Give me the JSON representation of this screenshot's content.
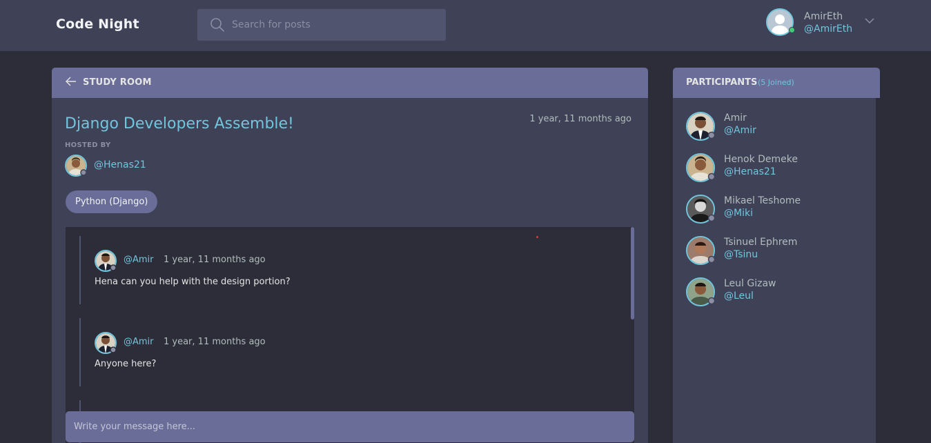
{
  "header": {
    "logo": "Code Night",
    "search_placeholder": "Search for posts",
    "user": {
      "name": "AmirEth",
      "handle": "@AmirEth"
    }
  },
  "room": {
    "back_label": "STUDY ROOM",
    "title": "Django Developers Assemble!",
    "time": "1 year, 11 months ago",
    "hosted_by_label": "HOSTED BY",
    "host_handle": "@Henas21",
    "topic": "Python (Django)",
    "messages": [
      {
        "handle": "@Amir",
        "time": "1 year, 11 months ago",
        "text": "Hena can you help with the design portion?"
      },
      {
        "handle": "@Amir",
        "time": "1 year, 11 months ago",
        "text": "Anyone here?"
      }
    ],
    "composer_placeholder": "Write your message here..."
  },
  "participants": {
    "title": "PARTICIPANTS",
    "count": "(5 Joined)",
    "items": [
      {
        "name": "Amir",
        "handle": "@Amir"
      },
      {
        "name": "Henok Demeke",
        "handle": "@Henas21"
      },
      {
        "name": "Mikael Teshome",
        "handle": "@Miki"
      },
      {
        "name": "Tsinuel Ephrem",
        "handle": "@Tsinu"
      },
      {
        "name": "Leul Gizaw",
        "handle": "@Leul"
      }
    ]
  },
  "colors": {
    "accent": "#71c6dd",
    "panel": "#3f4156",
    "panel_header": "#696d97",
    "background": "#2d2d39",
    "online": "#44c97a"
  }
}
